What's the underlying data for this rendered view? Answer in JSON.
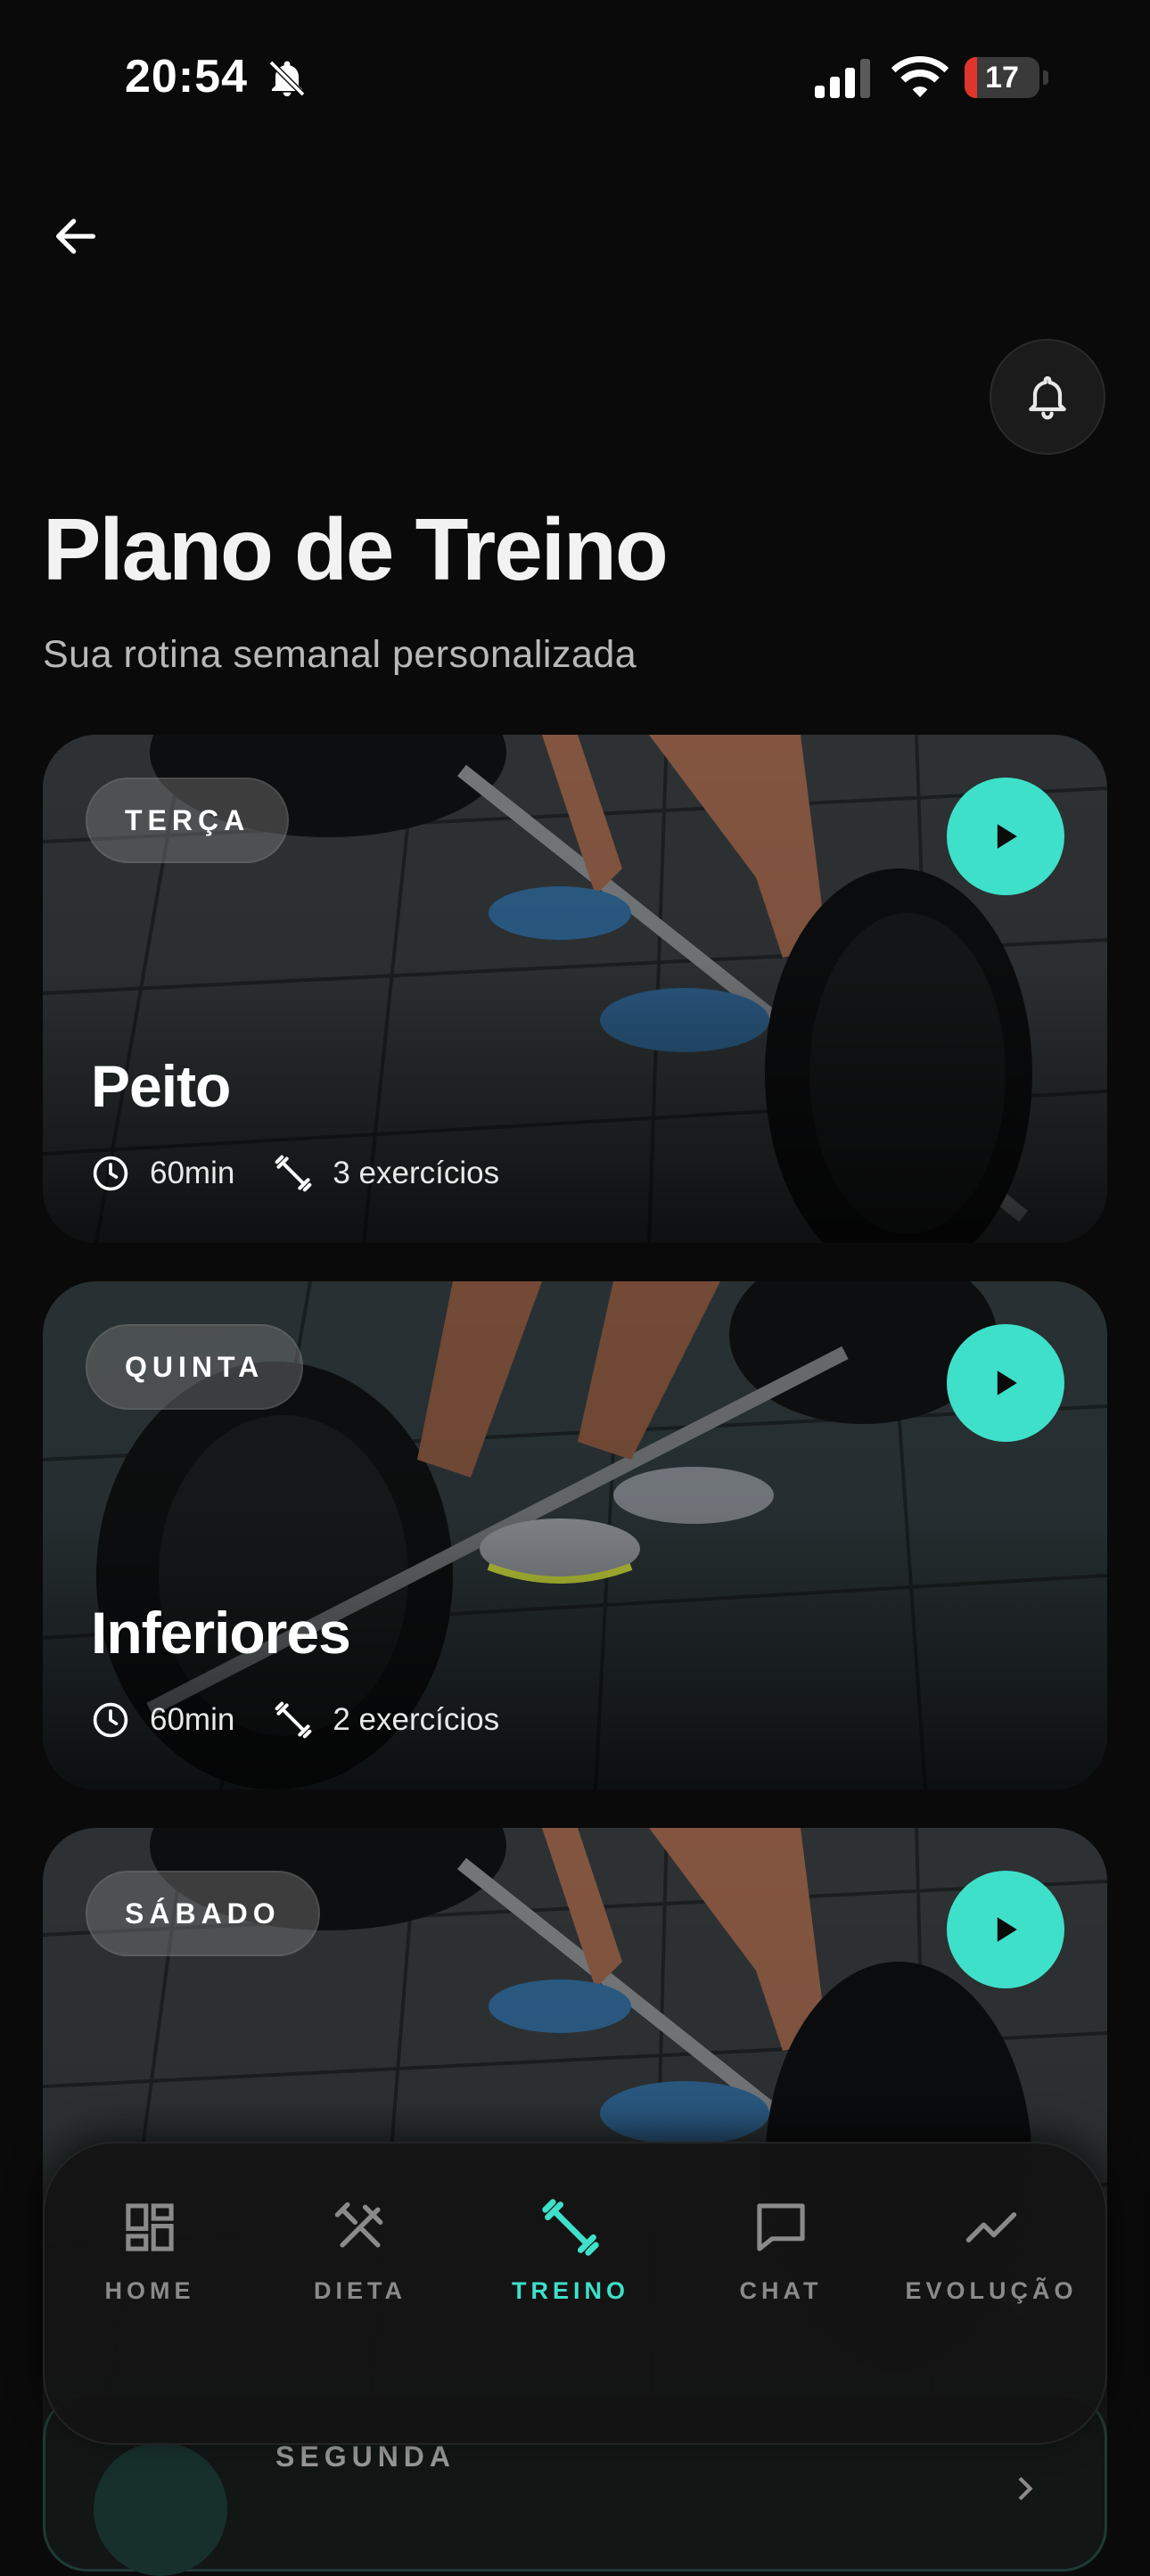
{
  "status_bar": {
    "time": "20:54",
    "battery": "17",
    "battery_level": 0.17
  },
  "header": {
    "title": "Plano de Treino",
    "subtitle": "Sua rotina semanal personalizada"
  },
  "workouts": [
    {
      "day": "TERÇA",
      "title": "Peito",
      "duration": "60min",
      "exercises": "3 exercícios"
    },
    {
      "day": "QUINTA",
      "title": "Inferiores",
      "duration": "60min",
      "exercises": "2 exercícios"
    },
    {
      "day": "SÁBADO"
    }
  ],
  "nav": {
    "items": [
      {
        "label": "HOME",
        "icon": "dashboard-icon"
      },
      {
        "label": "DIETA",
        "icon": "utensils-icon"
      },
      {
        "label": "TREINO",
        "icon": "dumbbell-icon",
        "active": true
      },
      {
        "label": "CHAT",
        "icon": "chat-icon"
      },
      {
        "label": "EVOLUÇÃO",
        "icon": "trend-icon"
      }
    ]
  },
  "peek": {
    "label": "SEGUNDA"
  },
  "colors": {
    "accent": "#3ee0c9",
    "background": "#0a0a0a",
    "battery_low": "#e0352b"
  }
}
